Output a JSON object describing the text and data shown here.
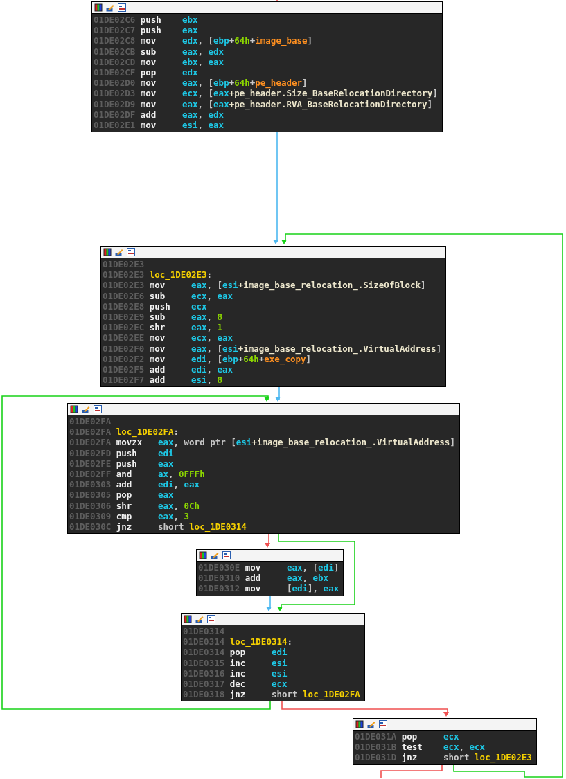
{
  "blocks": [
    {
      "lines": [
        {
          "address": "01DE02C6",
          "mnemonic": "push",
          "operands": [
            {
              "kind": "reg",
              "text": "ebx"
            }
          ]
        },
        {
          "address": "01DE02C7",
          "mnemonic": "push",
          "operands": [
            {
              "kind": "reg",
              "text": "eax"
            }
          ]
        },
        {
          "address": "01DE02C8",
          "mnemonic": "mov",
          "operands": [
            {
              "kind": "reg",
              "text": "edx"
            },
            {
              "kind": "text",
              "text": ", ["
            },
            {
              "kind": "reg",
              "text": "ebp"
            },
            {
              "kind": "text",
              "text": "+"
            },
            {
              "kind": "num",
              "text": "64h"
            },
            {
              "kind": "text",
              "text": "+"
            },
            {
              "kind": "var",
              "text": "image_base"
            },
            {
              "kind": "text",
              "text": "]"
            }
          ]
        },
        {
          "address": "01DE02CB",
          "mnemonic": "sub",
          "operands": [
            {
              "kind": "reg",
              "text": "eax"
            },
            {
              "kind": "text",
              "text": ", "
            },
            {
              "kind": "reg",
              "text": "edx"
            }
          ]
        },
        {
          "address": "01DE02CD",
          "mnemonic": "mov",
          "operands": [
            {
              "kind": "reg",
              "text": "ebx"
            },
            {
              "kind": "text",
              "text": ", "
            },
            {
              "kind": "reg",
              "text": "eax"
            }
          ]
        },
        {
          "address": "01DE02CF",
          "mnemonic": "pop",
          "operands": [
            {
              "kind": "reg",
              "text": "edx"
            }
          ]
        },
        {
          "address": "01DE02D0",
          "mnemonic": "mov",
          "operands": [
            {
              "kind": "reg",
              "text": "eax"
            },
            {
              "kind": "text",
              "text": ", ["
            },
            {
              "kind": "reg",
              "text": "ebp"
            },
            {
              "kind": "text",
              "text": "+"
            },
            {
              "kind": "num",
              "text": "64h"
            },
            {
              "kind": "text",
              "text": "+"
            },
            {
              "kind": "var",
              "text": "pe_header"
            },
            {
              "kind": "text",
              "text": "]"
            }
          ]
        },
        {
          "address": "01DE02D3",
          "mnemonic": "mov",
          "operands": [
            {
              "kind": "reg",
              "text": "ecx"
            },
            {
              "kind": "text",
              "text": ", ["
            },
            {
              "kind": "reg",
              "text": "eax"
            },
            {
              "kind": "field",
              "text": "+pe_header.Size_BaseRelocationDirectory"
            },
            {
              "kind": "text",
              "text": "]"
            }
          ]
        },
        {
          "address": "01DE02D9",
          "mnemonic": "mov",
          "operands": [
            {
              "kind": "reg",
              "text": "eax"
            },
            {
              "kind": "text",
              "text": ", ["
            },
            {
              "kind": "reg",
              "text": "eax"
            },
            {
              "kind": "field",
              "text": "+pe_header.RVA_BaseRelocationDirectory"
            },
            {
              "kind": "text",
              "text": "]"
            }
          ]
        },
        {
          "address": "01DE02DF",
          "mnemonic": "add",
          "operands": [
            {
              "kind": "reg",
              "text": "eax"
            },
            {
              "kind": "text",
              "text": ", "
            },
            {
              "kind": "reg",
              "text": "edx"
            }
          ]
        },
        {
          "address": "01DE02E1",
          "mnemonic": "mov",
          "operands": [
            {
              "kind": "reg",
              "text": "esi"
            },
            {
              "kind": "text",
              "text": ", "
            },
            {
              "kind": "reg",
              "text": "eax"
            }
          ]
        }
      ]
    },
    {
      "lines": [
        {
          "address": "01DE02E3"
        },
        {
          "address": "01DE02E3",
          "operands": [
            {
              "kind": "label",
              "text": "loc_1DE02E3"
            },
            {
              "kind": "text",
              "text": ":"
            }
          ]
        },
        {
          "address": "01DE02E3",
          "mnemonic": "mov",
          "operands": [
            {
              "kind": "reg",
              "text": "eax"
            },
            {
              "kind": "text",
              "text": ", ["
            },
            {
              "kind": "reg",
              "text": "esi"
            },
            {
              "kind": "field",
              "text": "+image_base_relocation_.SizeOfBlock"
            },
            {
              "kind": "text",
              "text": "]"
            }
          ]
        },
        {
          "address": "01DE02E6",
          "mnemonic": "sub",
          "operands": [
            {
              "kind": "reg",
              "text": "ecx"
            },
            {
              "kind": "text",
              "text": ", "
            },
            {
              "kind": "reg",
              "text": "eax"
            }
          ]
        },
        {
          "address": "01DE02E8",
          "mnemonic": "push",
          "operands": [
            {
              "kind": "reg",
              "text": "ecx"
            }
          ]
        },
        {
          "address": "01DE02E9",
          "mnemonic": "sub",
          "operands": [
            {
              "kind": "reg",
              "text": "eax"
            },
            {
              "kind": "text",
              "text": ", "
            },
            {
              "kind": "num",
              "text": "8"
            }
          ]
        },
        {
          "address": "01DE02EC",
          "mnemonic": "shr",
          "operands": [
            {
              "kind": "reg",
              "text": "eax"
            },
            {
              "kind": "text",
              "text": ", "
            },
            {
              "kind": "num",
              "text": "1"
            }
          ]
        },
        {
          "address": "01DE02EE",
          "mnemonic": "mov",
          "operands": [
            {
              "kind": "reg",
              "text": "ecx"
            },
            {
              "kind": "text",
              "text": ", "
            },
            {
              "kind": "reg",
              "text": "eax"
            }
          ]
        },
        {
          "address": "01DE02F0",
          "mnemonic": "mov",
          "operands": [
            {
              "kind": "reg",
              "text": "eax"
            },
            {
              "kind": "text",
              "text": ", ["
            },
            {
              "kind": "reg",
              "text": "esi"
            },
            {
              "kind": "field",
              "text": "+image_base_relocation_.VirtualAddress"
            },
            {
              "kind": "text",
              "text": "]"
            }
          ]
        },
        {
          "address": "01DE02F2",
          "mnemonic": "mov",
          "operands": [
            {
              "kind": "reg",
              "text": "edi"
            },
            {
              "kind": "text",
              "text": ", ["
            },
            {
              "kind": "reg",
              "text": "ebp"
            },
            {
              "kind": "text",
              "text": "+"
            },
            {
              "kind": "num",
              "text": "64h"
            },
            {
              "kind": "text",
              "text": "+"
            },
            {
              "kind": "var",
              "text": "exe_copy"
            },
            {
              "kind": "text",
              "text": "]"
            }
          ]
        },
        {
          "address": "01DE02F5",
          "mnemonic": "add",
          "operands": [
            {
              "kind": "reg",
              "text": "edi"
            },
            {
              "kind": "text",
              "text": ", "
            },
            {
              "kind": "reg",
              "text": "eax"
            }
          ]
        },
        {
          "address": "01DE02F7",
          "mnemonic": "add",
          "operands": [
            {
              "kind": "reg",
              "text": "esi"
            },
            {
              "kind": "text",
              "text": ", "
            },
            {
              "kind": "num",
              "text": "8"
            }
          ]
        }
      ]
    },
    {
      "lines": [
        {
          "address": "01DE02FA"
        },
        {
          "address": "01DE02FA",
          "operands": [
            {
              "kind": "label",
              "text": "loc_1DE02FA"
            },
            {
              "kind": "text",
              "text": ":"
            }
          ]
        },
        {
          "address": "01DE02FA",
          "mnemonic": "movzx",
          "operands": [
            {
              "kind": "reg",
              "text": "eax"
            },
            {
              "kind": "text",
              "text": ", word ptr ["
            },
            {
              "kind": "reg",
              "text": "esi"
            },
            {
              "kind": "field",
              "text": "+image_base_relocation_.VirtualAddress"
            },
            {
              "kind": "text",
              "text": "]"
            }
          ]
        },
        {
          "address": "01DE02FD",
          "mnemonic": "push",
          "operands": [
            {
              "kind": "reg",
              "text": "edi"
            }
          ]
        },
        {
          "address": "01DE02FE",
          "mnemonic": "push",
          "operands": [
            {
              "kind": "reg",
              "text": "eax"
            }
          ]
        },
        {
          "address": "01DE02FF",
          "mnemonic": "and",
          "operands": [
            {
              "kind": "reg",
              "text": "ax"
            },
            {
              "kind": "text",
              "text": ", "
            },
            {
              "kind": "num",
              "text": "0FFFh"
            }
          ]
        },
        {
          "address": "01DE0303",
          "mnemonic": "add",
          "operands": [
            {
              "kind": "reg",
              "text": "edi"
            },
            {
              "kind": "text",
              "text": ", "
            },
            {
              "kind": "reg",
              "text": "eax"
            }
          ]
        },
        {
          "address": "01DE0305",
          "mnemonic": "pop",
          "operands": [
            {
              "kind": "reg",
              "text": "eax"
            }
          ]
        },
        {
          "address": "01DE0306",
          "mnemonic": "shr",
          "operands": [
            {
              "kind": "reg",
              "text": "eax"
            },
            {
              "kind": "text",
              "text": ", "
            },
            {
              "kind": "num",
              "text": "0Ch"
            }
          ]
        },
        {
          "address": "01DE0309",
          "mnemonic": "cmp",
          "operands": [
            {
              "kind": "reg",
              "text": "eax"
            },
            {
              "kind": "text",
              "text": ", "
            },
            {
              "kind": "num",
              "text": "3"
            }
          ]
        },
        {
          "address": "01DE030C",
          "mnemonic": "jnz",
          "operands": [
            {
              "kind": "text",
              "text": "short "
            },
            {
              "kind": "label",
              "text": "loc_1DE0314"
            }
          ]
        }
      ]
    },
    {
      "lines": [
        {
          "address": "01DE030E",
          "mnemonic": "mov",
          "operands": [
            {
              "kind": "reg",
              "text": "eax"
            },
            {
              "kind": "text",
              "text": ", ["
            },
            {
              "kind": "reg",
              "text": "edi"
            },
            {
              "kind": "text",
              "text": "]"
            }
          ]
        },
        {
          "address": "01DE0310",
          "mnemonic": "add",
          "operands": [
            {
              "kind": "reg",
              "text": "eax"
            },
            {
              "kind": "text",
              "text": ", "
            },
            {
              "kind": "reg",
              "text": "ebx"
            }
          ]
        },
        {
          "address": "01DE0312",
          "mnemonic": "mov",
          "operands": [
            {
              "kind": "text",
              "text": "["
            },
            {
              "kind": "reg",
              "text": "edi"
            },
            {
              "kind": "text",
              "text": "], "
            },
            {
              "kind": "reg",
              "text": "eax"
            }
          ]
        }
      ]
    },
    {
      "lines": [
        {
          "address": "01DE0314"
        },
        {
          "address": "01DE0314",
          "operands": [
            {
              "kind": "label",
              "text": "loc_1DE0314"
            },
            {
              "kind": "text",
              "text": ":"
            }
          ]
        },
        {
          "address": "01DE0314",
          "mnemonic": "pop",
          "operands": [
            {
              "kind": "reg",
              "text": "edi"
            }
          ]
        },
        {
          "address": "01DE0315",
          "mnemonic": "inc",
          "operands": [
            {
              "kind": "reg",
              "text": "esi"
            }
          ]
        },
        {
          "address": "01DE0316",
          "mnemonic": "inc",
          "operands": [
            {
              "kind": "reg",
              "text": "esi"
            }
          ]
        },
        {
          "address": "01DE0317",
          "mnemonic": "dec",
          "operands": [
            {
              "kind": "reg",
              "text": "ecx"
            }
          ]
        },
        {
          "address": "01DE0318",
          "mnemonic": "jnz",
          "operands": [
            {
              "kind": "text",
              "text": "short "
            },
            {
              "kind": "label",
              "text": "loc_1DE02FA"
            }
          ]
        }
      ]
    },
    {
      "lines": [
        {
          "address": "01DE031A",
          "mnemonic": "pop",
          "operands": [
            {
              "kind": "reg",
              "text": "ecx"
            }
          ]
        },
        {
          "address": "01DE031B",
          "mnemonic": "test",
          "operands": [
            {
              "kind": "reg",
              "text": "ecx"
            },
            {
              "kind": "text",
              "text": ", "
            },
            {
              "kind": "reg",
              "text": "ecx"
            }
          ]
        },
        {
          "address": "01DE031D",
          "mnemonic": "jnz",
          "operands": [
            {
              "kind": "text",
              "text": "short "
            },
            {
              "kind": "label",
              "text": "loc_1DE02E3"
            }
          ]
        }
      ]
    }
  ],
  "edges": [
    {
      "kind": "false"
    },
    {
      "kind": "flow"
    },
    {
      "kind": "true"
    },
    {
      "kind": "flow"
    },
    {
      "kind": "true"
    },
    {
      "kind": "false"
    },
    {
      "kind": "true"
    },
    {
      "kind": "flow"
    },
    {
      "kind": "false"
    },
    {
      "kind": "false"
    }
  ]
}
